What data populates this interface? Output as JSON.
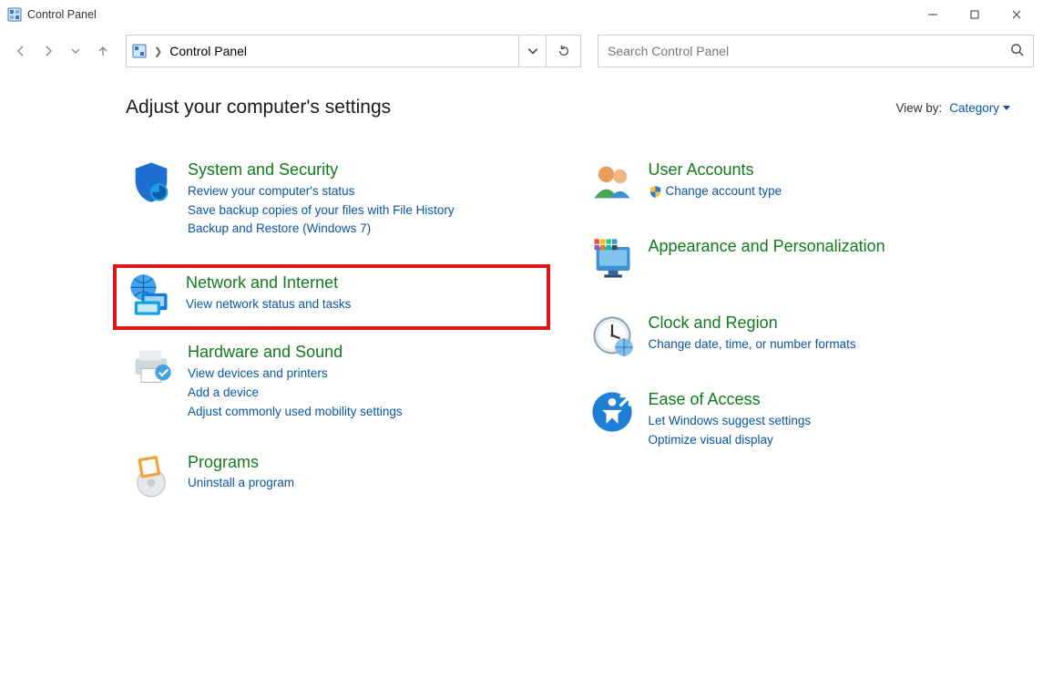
{
  "window": {
    "title": "Control Panel"
  },
  "breadcrumb": {
    "location": "Control Panel"
  },
  "search": {
    "placeholder": "Search Control Panel"
  },
  "page": {
    "heading": "Adjust your computer's settings",
    "viewby_label": "View by:",
    "viewby_value": "Category"
  },
  "left": [
    {
      "id": "system-security",
      "title": "System and Security",
      "links": [
        "Review your computer's status",
        "Save backup copies of your files with File History",
        "Backup and Restore (Windows 7)"
      ]
    },
    {
      "id": "network-internet",
      "title": "Network and Internet",
      "links": [
        "View network status and tasks"
      ],
      "highlight": true
    },
    {
      "id": "hardware-sound",
      "title": "Hardware and Sound",
      "links": [
        "View devices and printers",
        "Add a device",
        "Adjust commonly used mobility settings"
      ]
    },
    {
      "id": "programs",
      "title": "Programs",
      "links": [
        "Uninstall a program"
      ]
    }
  ],
  "right": [
    {
      "id": "user-accounts",
      "title": "User Accounts",
      "links": [
        "Change account type"
      ],
      "shield_on_first": true
    },
    {
      "id": "appearance",
      "title": "Appearance and Personalization",
      "links": []
    },
    {
      "id": "clock-region",
      "title": "Clock and Region",
      "links": [
        "Change date, time, or number formats"
      ]
    },
    {
      "id": "ease-of-access",
      "title": "Ease of Access",
      "links": [
        "Let Windows suggest settings",
        "Optimize visual display"
      ]
    }
  ]
}
